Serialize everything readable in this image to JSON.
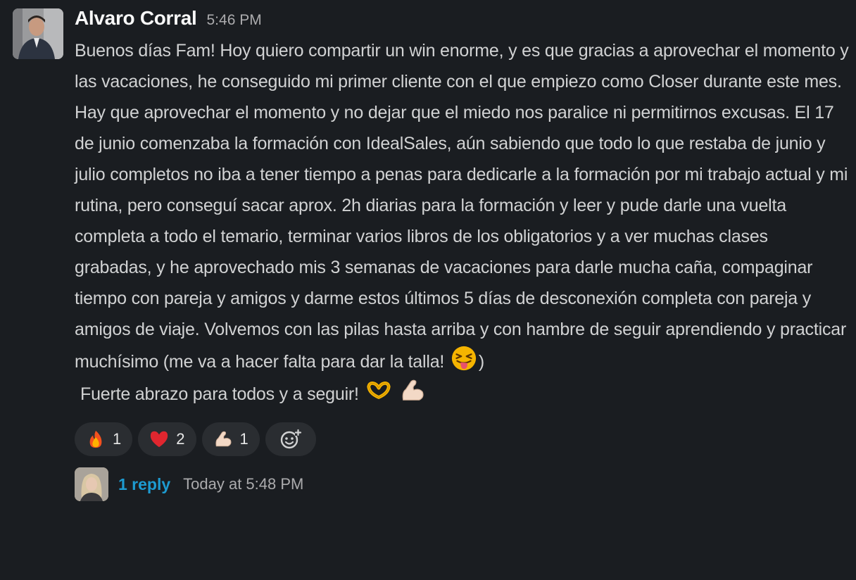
{
  "message": {
    "author": "Alvaro Corral",
    "time": "5:46 PM",
    "paragraph": "Buenos días Fam! Hoy quiero compartir un win enorme, y es que gracias a aprovechar el momento y las vacaciones, he conseguido mi primer cliente con el que empiezo como Closer durante este mes. Hay que aprovechar el momento y no dejar que el miedo nos paralice ni permitirnos excusas. El 17 de junio comenzaba la formación con IdealSales, aún sabiendo que todo lo que restaba de junio y julio completos no iba a tener tiempo a penas para dedicarle a la formación por mi trabajo actual y mi rutina, pero conseguí sacar aprox. 2h diarias para la formación y leer y pude darle una vuelta completa a todo el temario, terminar varios libros de los obligatorios y a ver muchas clases grabadas, y he aprovechado mis 3 semanas de vacaciones para darle mucha caña, compaginar tiempo con pareja y amigos y darme estos últimos 5 días de desconexión completa con pareja y amigos de viaje. Volvemos con las pilas hasta arriba y con hambre de seguir aprendiendo y practicar muchísimo (me va a hacer falta para dar la talla!",
    "paragraph_end": ")",
    "closing": "Fuerte abrazo para todos y a seguir!",
    "inline_emojis": [
      "squinting-tongue-face-emoji",
      "heart-hands-emoji",
      "flexed-biceps-emoji"
    ]
  },
  "reactions": [
    {
      "emoji": "fire-emoji",
      "count": "1"
    },
    {
      "emoji": "red-heart-emoji",
      "count": "2"
    },
    {
      "emoji": "flexed-biceps-emoji",
      "count": "1"
    }
  ],
  "add_reaction_icon": "add-emoji-icon",
  "thread": {
    "reply_label": "1 reply",
    "last_reply": "Today at 5:48 PM"
  },
  "colors": {
    "background": "#1a1d21",
    "text": "#d1d2d3",
    "link": "#1d9bd1",
    "muted": "#ababad",
    "pill": "#2a2d31"
  }
}
